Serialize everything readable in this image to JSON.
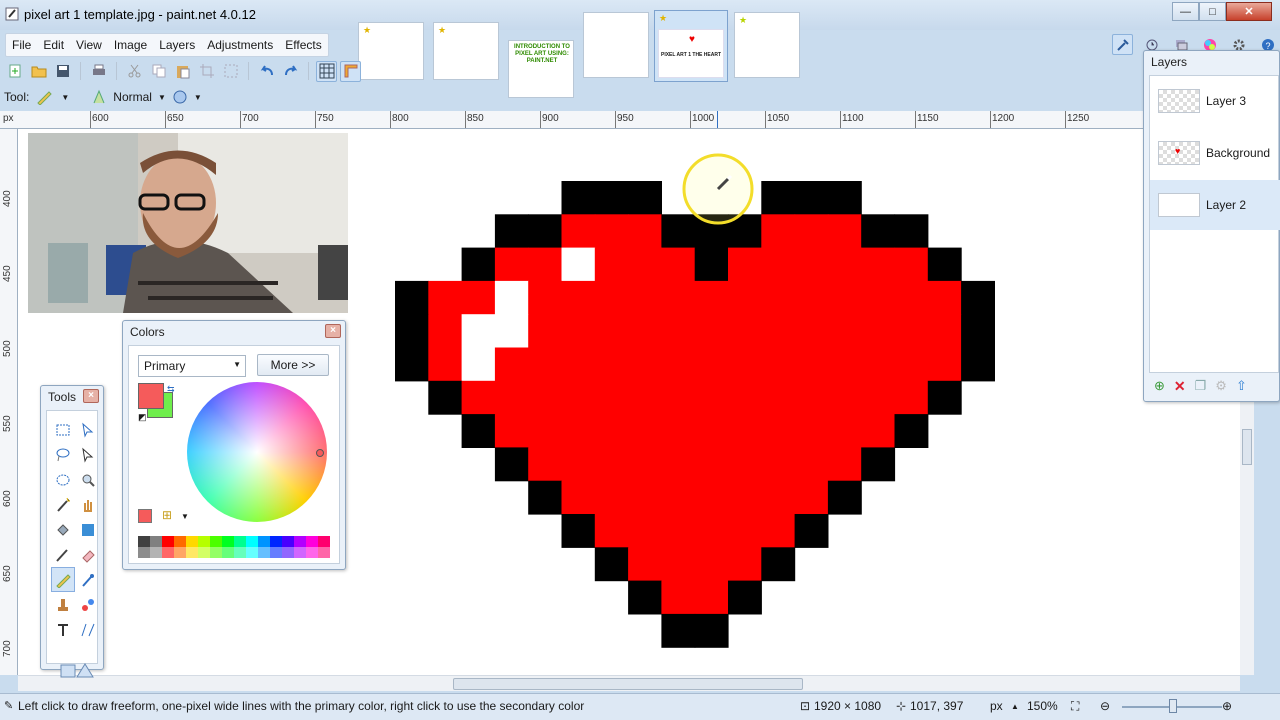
{
  "window": {
    "title": "pixel art 1 template.jpg - paint.net 4.0.12",
    "minimize": "—",
    "maximize": "□",
    "close": "✕"
  },
  "menu": [
    "File",
    "Edit",
    "View",
    "Image",
    "Layers",
    "Adjustments",
    "Effects"
  ],
  "thumb_texts": {
    "intro": "INTRODUCTION TO PIXEL ART USING: PAINT.NET",
    "heart": "PIXEL ART 1 THE HEART"
  },
  "options": {
    "tool_label": "Tool:",
    "blend_mode": "Normal"
  },
  "ruler": {
    "unit": "px",
    "top_labels": [
      "600",
      "650",
      "700",
      "750",
      "800",
      "850",
      "900",
      "950",
      "1000",
      "1050",
      "1100",
      "1150",
      "1200",
      "1250"
    ],
    "left_labels": [
      "400",
      "450",
      "500",
      "550",
      "600",
      "650",
      "700"
    ]
  },
  "colors_window": {
    "title": "Colors",
    "mode": "Primary",
    "more_button": "More >>",
    "primary_color": "#f55b5b",
    "secondary_color": "#6fee4c"
  },
  "tools_window": {
    "title": "Tools"
  },
  "layers_window": {
    "title": "Layers",
    "layers": [
      "Layer 3",
      "Background",
      "Layer 2"
    ],
    "selected": "Layer 2"
  },
  "status": {
    "hint": "Left click to draw freeform, one-pixel wide lines with the primary color, right click to use the secondary color",
    "image_size": "1920 × 1080",
    "cursor_pos": "1017, 397",
    "unit": "px",
    "zoom": "150%"
  },
  "heart_colors": {
    "outline": "#000000",
    "fill": "#ff0000",
    "highlight": "#ffffff"
  },
  "palette": [
    "#404040",
    "#808080",
    "#ff0000",
    "#ff6a00",
    "#ffd800",
    "#b6ff00",
    "#4cff00",
    "#00ff21",
    "#00ff90",
    "#00ffff",
    "#0094ff",
    "#0026ff",
    "#4800ff",
    "#b200ff",
    "#ff00dc",
    "#ff006e"
  ]
}
